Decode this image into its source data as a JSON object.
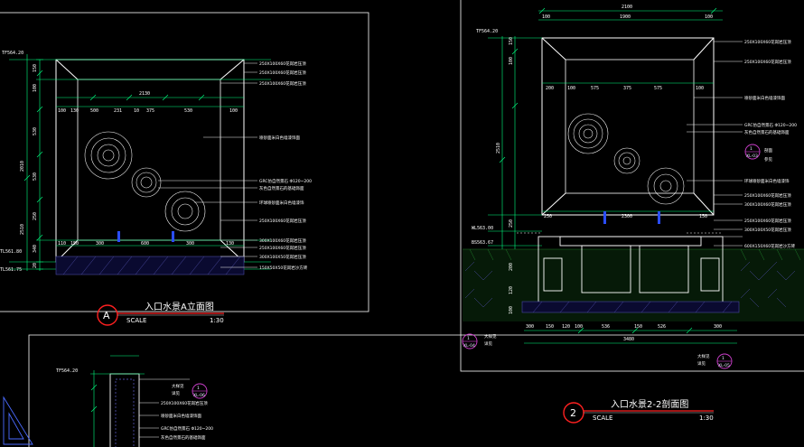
{
  "colors": {
    "background": "#000000",
    "outline": "#ffffff",
    "dimension": "#00ff80",
    "leader": "#f0f0f0",
    "title_underline": "#ff2020",
    "badge_circle": "#ff2020",
    "marker": "#d040d0",
    "water_jet": "#2a4dff",
    "soil": "#1f7a2a",
    "hatch": "#4a4aa0"
  },
  "view_a": {
    "badge": "A",
    "title": "入口水景A立面图",
    "scale_label": "SCALE",
    "scale_value": "1:30",
    "level_labels": [
      "TF564.20",
      "TL561.80",
      "TL561.75"
    ],
    "side_dims": [
      "150",
      "100",
      "530",
      "2010",
      "530",
      "250",
      "340",
      "20",
      "2510"
    ],
    "top_dims": [
      "100",
      "130",
      "500",
      "231",
      "10",
      "375",
      "530",
      "100"
    ],
    "overall_width": "2130",
    "bottom_dims": [
      "110",
      "150",
      "300",
      "600",
      "300",
      "130"
    ],
    "notes": [
      "250X100X60花岗岩压顶",
      "250X100X60花岗岩压顶",
      "250X100X60花岗岩压顶",
      "喷砂面米白色墙漆饰面",
      "GRC仿自然景石 Φ120~200",
      "灰色自然景石的基础饰面",
      "环球喷砂面米白色墙漆饰",
      "250X100X60花岗岩压顶",
      "300X100X60花岗岩压顶",
      "250X100X60花岗岩压顶",
      "300X100X50花岗岩压顶",
      "150X50X50花岗岩沙方砖"
    ]
  },
  "view_2": {
    "badge": "2",
    "title": "入口水景2-2剖面图",
    "scale_label": "SCALE",
    "scale_value": "1:30",
    "level_labels": [
      "TF564.20",
      "WL563.00",
      "BS563.67"
    ],
    "top_overall": "2100",
    "top_dims": [
      "100",
      "1900",
      "100"
    ],
    "top_dims2": [
      "200",
      "100",
      "575",
      "375",
      "575",
      "100"
    ],
    "mid_dims": [
      "250",
      "2300",
      "150"
    ],
    "side_dims": [
      "150",
      "100",
      "2510",
      "250",
      "200",
      "120",
      "100"
    ],
    "bottom_dims": [
      "300",
      "150",
      "120",
      "100",
      "536",
      "150",
      "526",
      "300"
    ],
    "bottom_overall": "3480",
    "notes": [
      "250X100X60花岗岩压顶",
      "250X100X60花岗岩压顶",
      "喷砂面米白色墙漆饰面",
      "GRC仿自然景石 Φ120~200",
      "灰色自然景石的基础饰面",
      "剖面",
      "参见",
      "环球喷砂面米白色墙漆饰",
      "250X100X60花岗岩压顶",
      "300X100X60花岗岩压顶",
      "250X100X60花岗岩压顶",
      "300X100X50花岗岩压顶",
      "600X150X60花岗岩沙方砖"
    ],
    "markers": [
      {
        "top": "1",
        "bottom": "XL-03"
      },
      {
        "top": "1",
        "bottom": "XL-04"
      },
      {
        "top": "1",
        "bottom": "XL-05"
      }
    ],
    "callouts": [
      "大样见",
      "详见",
      "大样见",
      "详见"
    ]
  },
  "view_b": {
    "level_label": "TF564.20",
    "marker": {
      "top": "1",
      "bottom": "XL-06"
    },
    "notes": [
      "大样见",
      "详见",
      "250X100X60花岗岩压顶",
      "喷砂面米白色墙漆饰面",
      "GRC仿自然景石 Φ120~200",
      "灰色自然景石的基础饰面"
    ]
  }
}
